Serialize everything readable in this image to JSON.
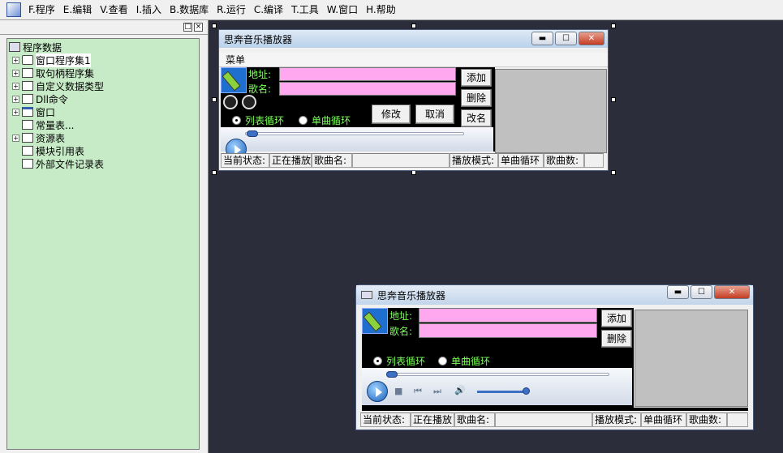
{
  "menubar": [
    "F.程序",
    "E.编辑",
    "V.查看",
    "I.插入",
    "B.数据库",
    "R.运行",
    "C.编译",
    "T.工具",
    "W.窗口",
    "H.帮助"
  ],
  "tree_panel": {
    "header_buttons": [
      "□",
      "×"
    ],
    "root": "程序数据",
    "items": [
      {
        "label": "窗口程序集1",
        "icon": "module-icon",
        "expandable": true
      },
      {
        "label": "取句柄程序集",
        "icon": "module-icon",
        "expandable": true
      },
      {
        "label": "自定义数据类型",
        "icon": "type-icon",
        "expandable": true
      },
      {
        "label": "Dll命令",
        "icon": "dll-icon",
        "expandable": true
      },
      {
        "label": "窗口",
        "icon": "window-icon",
        "expandable": true
      },
      {
        "label": "常量表...",
        "icon": "constant-icon",
        "expandable": false
      },
      {
        "label": "资源表",
        "icon": "resource-icon",
        "expandable": true
      },
      {
        "label": "模块引用表",
        "icon": "module-ref-icon",
        "expandable": false
      },
      {
        "label": "外部文件记录表",
        "icon": "file-record-icon",
        "expandable": false
      }
    ]
  },
  "design_window": {
    "title": "思奔音乐播放器",
    "controls": [
      "▬",
      "☐",
      "✕"
    ],
    "menu_label": "菜单",
    "address_label": "地址:",
    "song_label": "歌名:",
    "radio_list": "列表循环",
    "radio_single": "单曲循环",
    "btn_add": "添加",
    "btn_delete": "删除",
    "btn_rename": "改名",
    "btn_modify": "修改",
    "btn_cancel": "取消",
    "status": [
      "当前状态:",
      "正在播放",
      "歌曲名:",
      "",
      "播放模式:",
      "单曲循环",
      "歌曲数:",
      ""
    ]
  },
  "preview_window": {
    "title": "思奔音乐播放器",
    "controls": [
      "▬",
      "☐",
      "✕"
    ],
    "address_label": "地址:",
    "song_label": "歌名:",
    "radio_list": "列表循环",
    "radio_single": "单曲循环",
    "btn_add": "添加",
    "btn_delete": "删除",
    "status": [
      "当前状态:",
      "正在播放",
      "歌曲名:",
      "",
      "播放模式:",
      "单曲循环",
      "歌曲数:",
      ""
    ]
  },
  "colors": {
    "background": "#2b2d3a",
    "tree_bg": "#c7ebc7",
    "field_pink": "#ffa8f0",
    "label_green": "#7cff5a"
  }
}
